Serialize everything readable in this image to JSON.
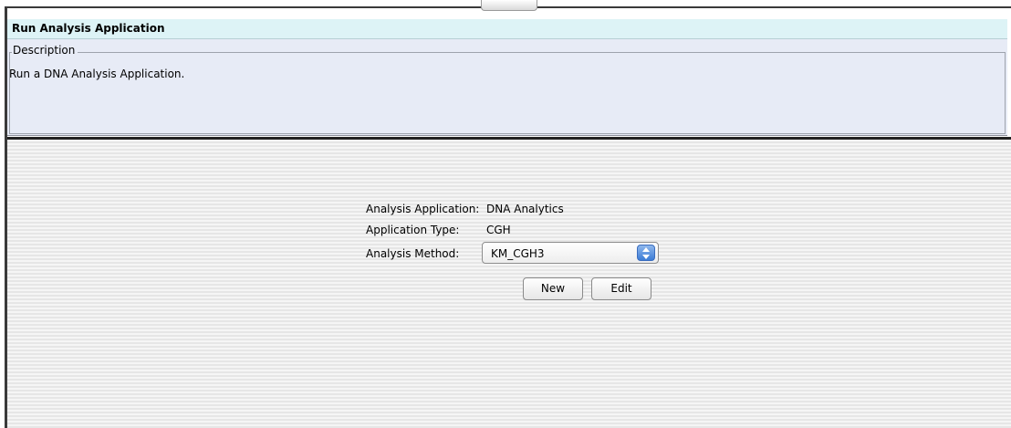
{
  "window": {
    "title": "Run Analysis Application"
  },
  "description": {
    "legend": "Description",
    "text": "Run a DNA Analysis Application."
  },
  "form": {
    "analysis_application_label": "Analysis Application:",
    "analysis_application_value": "DNA Analytics",
    "application_type_label": "Application Type:",
    "application_type_value": "CGH",
    "analysis_method_label": "Analysis Method:",
    "analysis_method_selected": "KM_CGH3"
  },
  "buttons": {
    "new_label": "New",
    "edit_label": "Edit"
  },
  "icons": {
    "select_arrows": "up-down-arrows-icon"
  },
  "colors": {
    "title_bar_bg": "#ddf3f6",
    "description_bg": "#e7ebf6",
    "select_arrow_blue": "#3c7cd6"
  }
}
